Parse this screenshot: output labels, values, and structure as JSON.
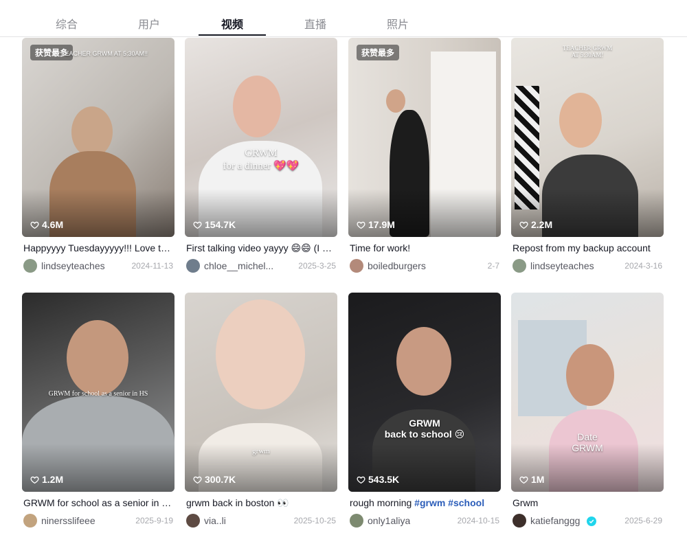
{
  "tabs": [
    {
      "label": "综合"
    },
    {
      "label": "用户"
    },
    {
      "label": "视频"
    },
    {
      "label": "直播"
    },
    {
      "label": "照片"
    }
  ],
  "videos": [
    {
      "badge": "获赞最多",
      "overlay_top": "TEACHER GRWM AT 5:30AM!!",
      "overlay_mid": "",
      "likes": "4.6M",
      "caption": "Happyyyy Tuesdayyyyy!!! Love these kiddos",
      "author": "lindseyteaches",
      "date": "2024-11-13"
    },
    {
      "badge": "",
      "overlay_top": "",
      "overlay_mid": "GRWM\nfor a dinner 💖💖",
      "likes": "154.7K",
      "caption": "First talking video yayyy 😄😄 (I was so nervous)",
      "author": "chloe__michel...",
      "date": "2025-3-25"
    },
    {
      "badge": "获赞最多",
      "overlay_top": "",
      "overlay_mid": "",
      "likes": "17.9M",
      "caption": "Time for work!",
      "author": "boiledburgers",
      "date": "2-7"
    },
    {
      "badge": "",
      "overlay_top": "TEACHER GRWM\nAT 5:30AM!",
      "overlay_mid": "",
      "likes": "2.2M",
      "caption": "Repost from my backup account",
      "author": "lindseyteaches",
      "date": "2024-3-16"
    },
    {
      "badge": "",
      "overlay_top": "",
      "overlay_mid": "GRWM for school as a senior in HS",
      "likes": "1.2M",
      "caption": "GRWM for school as a senior in HS",
      "author": "ninersslifeee",
      "date": "2025-9-19"
    },
    {
      "badge": "",
      "overlay_top": "",
      "overlay_mid": "grwm",
      "likes": "300.7K",
      "caption": "grwm back in boston 👀",
      "author": "via..li",
      "date": "2025-10-25"
    },
    {
      "badge": "",
      "overlay_top": "",
      "overlay_mid": "GRWM\nback to school 😢",
      "likes": "543.5K",
      "caption_text": "rough morning ",
      "caption_tags": "#grwm #school",
      "caption": "",
      "author": "only1aliya",
      "date": "2024-10-15"
    },
    {
      "badge": "",
      "overlay_top": "",
      "overlay_mid": "Date\nGRWM",
      "likes": "1M",
      "caption": "Grwm",
      "author": "katiefanggg",
      "date": "2025-6-29"
    }
  ],
  "colors": {
    "accent": "#161823",
    "hashtag": "#2b5db9",
    "verified": "#20d5ec"
  },
  "icons": {
    "like": "heart-outline-icon",
    "verified": "verified-check-icon"
  }
}
